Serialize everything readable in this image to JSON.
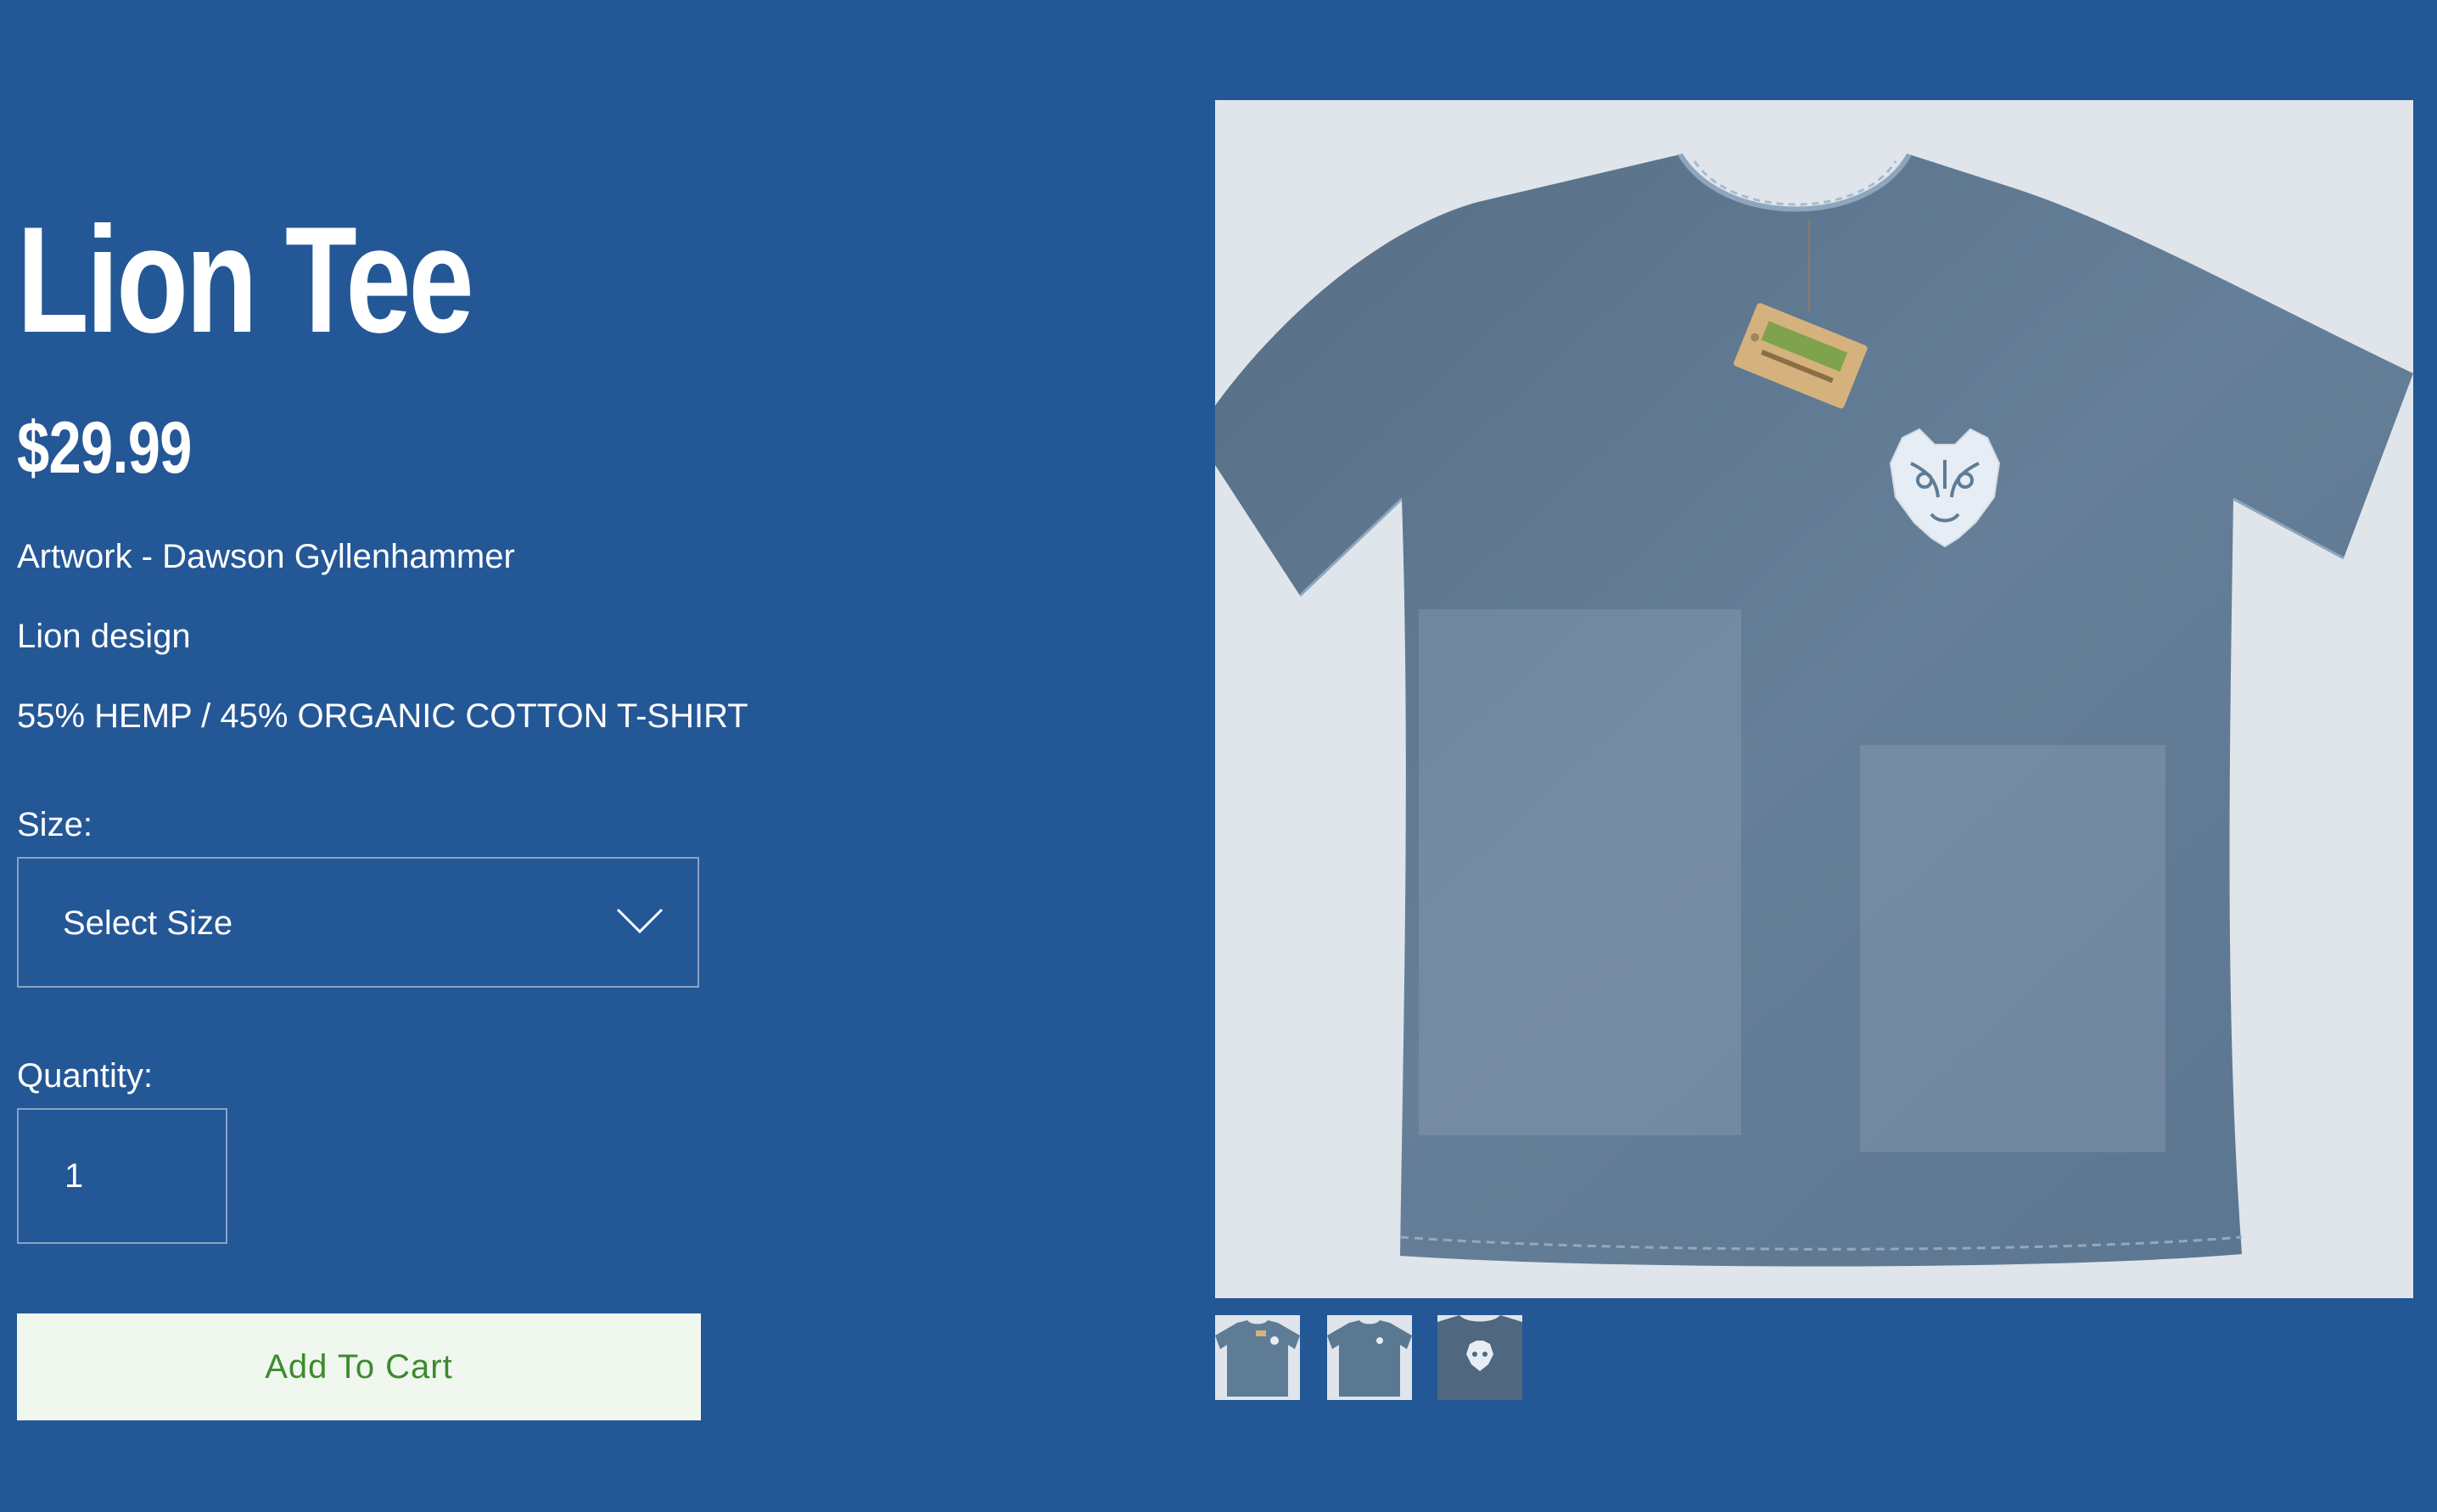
{
  "product": {
    "title": "Lion Tee",
    "price": "$29.99",
    "description": [
      "Artwork - Dawson Gyllenhammer",
      "Lion design",
      "55% HEMP / 45% ORGANIC COTTON T-SHIRT"
    ]
  },
  "size": {
    "label": "Size:",
    "selected": "Select Size"
  },
  "quantity": {
    "label": "Quantity:",
    "value": "1"
  },
  "cart": {
    "button_label": "Add To Cart"
  },
  "gallery": {
    "main_icon": "t-shirt-photo",
    "thumbnails": [
      {
        "icon": "t-shirt-front-with-tag-thumbnail"
      },
      {
        "icon": "t-shirt-front-thumbnail"
      },
      {
        "icon": "lion-print-closeup-thumbnail"
      }
    ]
  },
  "colors": {
    "background": "#245796",
    "text": "#ffffff",
    "button_bg": "#eff7ef",
    "button_text": "#3d8a2e",
    "shirt": "#5e7c95",
    "photo_bg": "#dfe5ea"
  }
}
